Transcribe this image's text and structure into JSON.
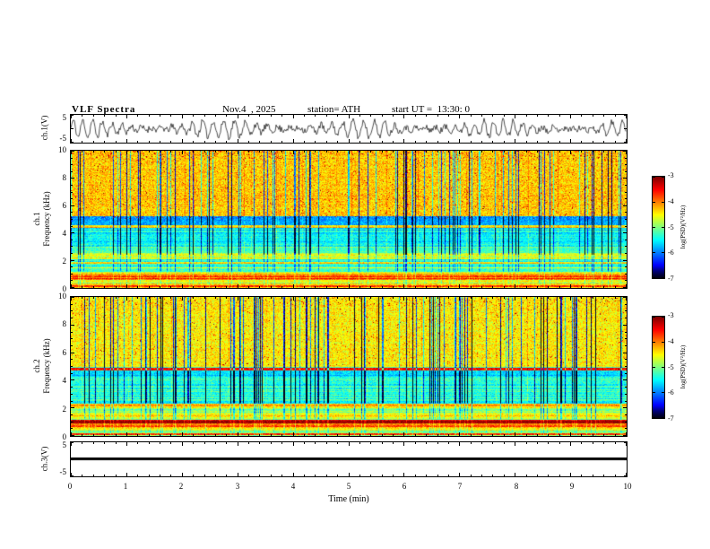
{
  "header": {
    "title": "VLF Spectra",
    "date": "Nov.4  , 2025",
    "station": "station= ATH",
    "start_ut": "start UT =  13:30: 0"
  },
  "time_axis": {
    "label": "Time (min)",
    "tick_labels": [
      "0",
      "1",
      "2",
      "3",
      "4",
      "5",
      "6",
      "7",
      "8",
      "9",
      "10"
    ],
    "range": [
      0,
      10
    ]
  },
  "panels": {
    "wave1": {
      "ylabel": "ch.1(V)",
      "ytick_labels": [
        "5",
        "-5"
      ],
      "ylim": [
        -5,
        5
      ]
    },
    "spec1": {
      "ylabel1": "ch.1",
      "ylabel2": "Frequency (kHz)",
      "ytick_labels": [
        "10",
        "8",
        "6",
        "4",
        "2",
        "0"
      ],
      "ylim": [
        0,
        10
      ]
    },
    "spec2": {
      "ylabel1": "ch.2",
      "ylabel2": "Frequency (kHz)",
      "ytick_labels": [
        "10",
        "8",
        "6",
        "4",
        "2",
        "0"
      ],
      "ylim": [
        0,
        10
      ]
    },
    "wave3": {
      "ylabel": "ch.3(V)",
      "ytick_labels": [
        "5",
        "-5"
      ],
      "ylim": [
        -5,
        5
      ]
    }
  },
  "colorbar": {
    "label": "log(PSD)(V²/Hz)",
    "tick_labels": [
      "-3",
      "-4",
      "-5",
      "-6",
      "-7"
    ],
    "range": [
      -7,
      -3
    ],
    "colormap": "jet"
  },
  "chart_data": [
    {
      "id": "ch1_waveform",
      "type": "line",
      "name": "ch.1 voltage waveform",
      "xlabel": "Time (min)",
      "ylabel": "ch.1(V)",
      "xlim": [
        0,
        10
      ],
      "ylim": [
        -5,
        5
      ],
      "seed": 11,
      "description": "Dense band-limited noise waveform oscillating between about -4.5 and +4.5 V over the full 10 minutes"
    },
    {
      "id": "ch1_spectrogram",
      "type": "heatmap",
      "name": "ch.1 power spectral density",
      "xlabel": "Time (min)",
      "ylabel": "ch.1 Frequency (kHz)",
      "value_label": "log(PSD)(V²/Hz)",
      "value_range": [
        -7,
        -3
      ],
      "xlim": [
        0,
        10
      ],
      "ylim": [
        0,
        10
      ],
      "colormap": "jet",
      "seed": 23,
      "bands": [
        {
          "f0": 5.2,
          "f1": 10.01,
          "level": -4.3
        },
        {
          "f0": 4.55,
          "f1": 5.2,
          "level": -5.9
        },
        {
          "f0": 4.35,
          "f1": 4.55,
          "level": -4.35
        },
        {
          "f0": 3.0,
          "f1": 4.35,
          "level": -5.5
        },
        {
          "f0": 2.55,
          "f1": 3.0,
          "level": -5.15
        },
        {
          "f0": 2.05,
          "f1": 2.55,
          "level": -4.6
        },
        {
          "f0": 1.76,
          "f1": 1.88,
          "level": -4.45
        },
        {
          "f0": 1.4,
          "f1": 1.5,
          "level": -4.55
        },
        {
          "f0": 1.15,
          "f1": 2.05,
          "level": -5.25
        },
        {
          "f0": 0.95,
          "f1": 1.15,
          "level": -4.45
        },
        {
          "f0": 0.55,
          "f1": 0.95,
          "level": -3.8
        },
        {
          "f0": 0.3,
          "f1": 0.55,
          "level": -4.7
        },
        {
          "f0": 0.05,
          "f1": 0.18,
          "level": -3.7
        },
        {
          "f0": 0.0,
          "f1": 0.3,
          "level": -4.3
        }
      ],
      "streaks": {
        "dark_prob": 0.13,
        "dark_min": 0.9,
        "dark_max": 2.6
      },
      "speckle": {
        "prob": 0.02,
        "top_prob": 0.06
      }
    },
    {
      "id": "ch2_spectrogram",
      "type": "heatmap",
      "name": "ch.2 power spectral density",
      "xlabel": "Time (min)",
      "ylabel": "ch.2 Frequency (kHz)",
      "value_label": "log(PSD)(V²/Hz)",
      "value_range": [
        -7,
        -3
      ],
      "xlim": [
        0,
        10
      ],
      "ylim": [
        0,
        10
      ],
      "colormap": "jet",
      "seed": 57,
      "bands": [
        {
          "f0": 5.0,
          "f1": 10.01,
          "level": -4.45
        },
        {
          "f0": 4.88,
          "f1": 5.0,
          "level": -5.2
        },
        {
          "f0": 4.72,
          "f1": 4.88,
          "level": -3.6
        },
        {
          "f0": 4.3,
          "f1": 4.72,
          "level": -5.6
        },
        {
          "f0": 2.3,
          "f1": 4.3,
          "level": -5.35
        },
        {
          "f0": 1.95,
          "f1": 2.3,
          "level": -4.3
        },
        {
          "f0": 1.6,
          "f1": 1.95,
          "level": -4.9
        },
        {
          "f0": 1.35,
          "f1": 1.6,
          "level": -4.35
        },
        {
          "f0": 1.15,
          "f1": 1.35,
          "level": -4.85
        },
        {
          "f0": 0.85,
          "f1": 1.15,
          "level": -3.15
        },
        {
          "f0": 0.6,
          "f1": 0.85,
          "level": -3.9
        },
        {
          "f0": 0.35,
          "f1": 0.6,
          "level": -4.45
        },
        {
          "f0": 0.05,
          "f1": 0.18,
          "level": -3.7
        },
        {
          "f0": 0.0,
          "f1": 0.35,
          "level": -4.9
        }
      ],
      "streaks": {
        "dark_prob": 0.15,
        "dark_min": 1.0,
        "dark_max": 2.8
      },
      "speckle": {
        "prob": 0.012,
        "top_prob": 0.035
      }
    },
    {
      "id": "ch3_waveform",
      "type": "line",
      "name": "ch.3 voltage waveform",
      "xlabel": "Time (min)",
      "ylabel": "ch.3(V)",
      "xlim": [
        0,
        10
      ],
      "ylim": [
        -5,
        5
      ],
      "constant_value": 0,
      "seed": 0,
      "description": "Flat thick line at 0 V for the full 10 minutes (inactive channel)"
    }
  ]
}
